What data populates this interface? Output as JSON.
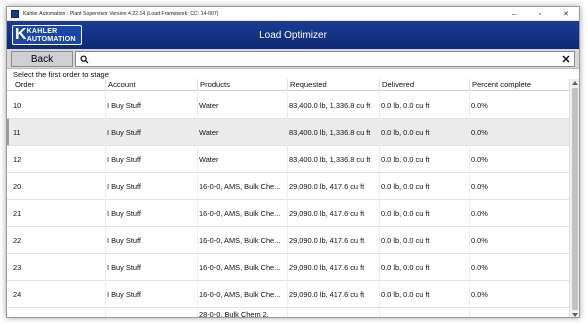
{
  "window": {
    "title": "Kahler Automation : Plant Supervisor Version 4.22.14 (Load Framework: CC: 14-007)",
    "controls": {
      "minimize": "–",
      "maximize": "▫",
      "close": "✕"
    }
  },
  "header": {
    "logo_letter": "K",
    "logo_line1": "KAHLER",
    "logo_line2": "AUTOMATION",
    "title": "Load Optimizer"
  },
  "toolbar": {
    "back_label": "Back",
    "search_value": "",
    "search_placeholder": ""
  },
  "instruction": "Select the first order to stage",
  "table": {
    "columns": [
      "Order",
      "Account",
      "Products",
      "Requested",
      "Delivered",
      "Percent complete"
    ],
    "rows": [
      {
        "order": "10",
        "account": "I Buy Stuff",
        "products": "Water",
        "requested": "83,400.0 lb, 1,336.8 cu ft",
        "delivered": "0.0 lb, 0.0 cu ft",
        "percent": "0.0%"
      },
      {
        "order": "11",
        "account": "I Buy Stuff",
        "products": "Water",
        "requested": "83,400.0 lb, 1,336.8 cu ft",
        "delivered": "0.0 lb, 0.0 cu ft",
        "percent": "0.0%"
      },
      {
        "order": "12",
        "account": "I Buy Stuff",
        "products": "Water",
        "requested": "83,400.0 lb, 1,336.8 cu ft",
        "delivered": "0.0 lb, 0.0 cu ft",
        "percent": "0.0%"
      },
      {
        "order": "20",
        "account": "I Buy Stuff",
        "products": "16-0-0, AMS, Bulk Che...",
        "requested": "29,090.0 lb, 417.6 cu ft",
        "delivered": "0.0 lb, 0.0 cu ft",
        "percent": "0.0%"
      },
      {
        "order": "21",
        "account": "I Buy Stuff",
        "products": "16-0-0, AMS, Bulk Che...",
        "requested": "29,090.0 lb, 417.6 cu ft",
        "delivered": "0.0 lb, 0.0 cu ft",
        "percent": "0.0%"
      },
      {
        "order": "22",
        "account": "I Buy Stuff",
        "products": "16-0-0, AMS, Bulk Che...",
        "requested": "29,090.0 lb, 417.6 cu ft",
        "delivered": "0.0 lb, 0.0 cu ft",
        "percent": "0.0%"
      },
      {
        "order": "23",
        "account": "I Buy Stuff",
        "products": "16-0-0, AMS, Bulk Che...",
        "requested": "29,090.0 lb, 417.6 cu ft",
        "delivered": "0.0 lb, 0.0 cu ft",
        "percent": "0.0%"
      },
      {
        "order": "24",
        "account": "I Buy Stuff",
        "products": "16-0-0, AMS, Bulk Che...",
        "requested": "29,090.0 lb, 417.6 cu ft",
        "delivered": "0.0 lb, 0.0 cu ft",
        "percent": "0.0%"
      },
      {
        "order": "",
        "account": "",
        "products": "28-0-0, Bulk Chem 2,",
        "requested": "",
        "delivered": "",
        "percent": ""
      }
    ]
  },
  "colors": {
    "header_bg": "#1a3c94",
    "selected_row_bg": "#ebebeb",
    "toolbar_bg": "#d8d8d8"
  },
  "icons": {
    "search": "search-icon",
    "clear": "close-icon",
    "app": "app-icon"
  }
}
